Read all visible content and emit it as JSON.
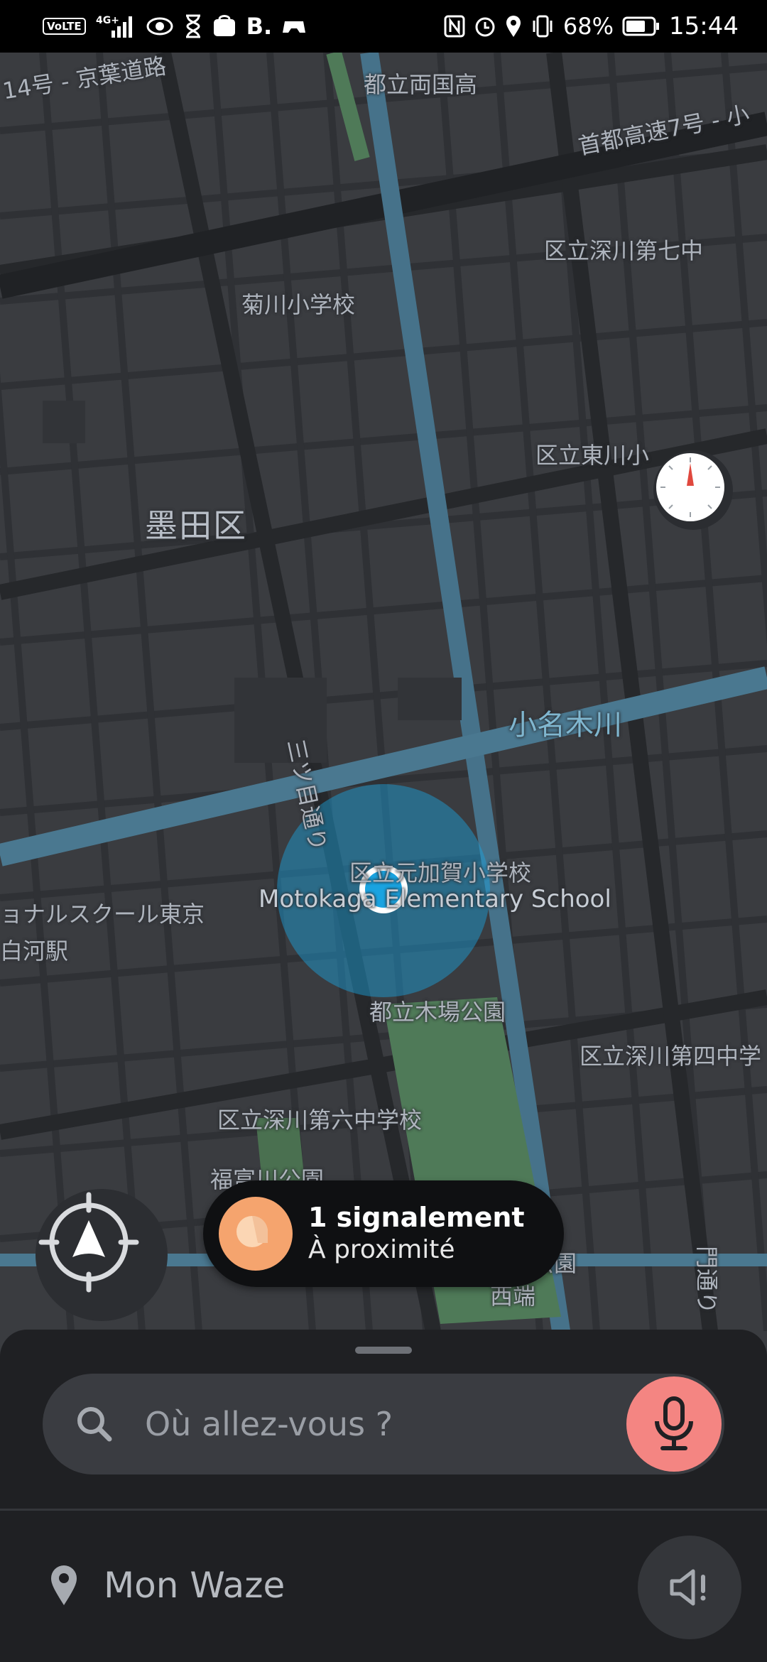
{
  "status_bar": {
    "network_chip": "VoLTE",
    "network_type": "4G+",
    "carrier_letter": "B.",
    "battery": "68%",
    "time": "15:44"
  },
  "map": {
    "labels": {
      "route14": "14号 - 京葉道路",
      "ryogoku_high": "都立両国高",
      "shuto7": "首都高速7号 - 小",
      "fukagawa7": "区立深川第七中",
      "kikukawa": "菊川小学校",
      "higashikawa": "区立東川小",
      "sumida_ku": "墨田区",
      "onagigawa": "小名木川",
      "mitsume": "三ツ目通り",
      "motokaga_jp": "区立元加賀小学校",
      "motokaga_en": "Motokaga Elementary School",
      "intl_school": "ョナルスクール東京",
      "shirakawa": "白河駅",
      "kiba_park": "都立木場公園",
      "fukagawa4": "区立深川第四中学",
      "fukagawa6": "区立深川第六中学校",
      "fukutomi": "福富川公園",
      "koboribe": "古堀川公園",
      "nishihata": "西端",
      "monzen": "門通り"
    }
  },
  "report": {
    "title": "1 signalement",
    "subtitle": "À proximité"
  },
  "search": {
    "placeholder": "Où allez-vous ?"
  },
  "bottom": {
    "my_waze": "Mon Waze"
  },
  "colors": {
    "map_bg": "#3a3c40",
    "road": "#2b2d31",
    "water": "#4a7890",
    "park": "#4f7a58",
    "location": "#1aa3e0",
    "mic": "#f48582",
    "report_icon": "#f5a46e"
  }
}
